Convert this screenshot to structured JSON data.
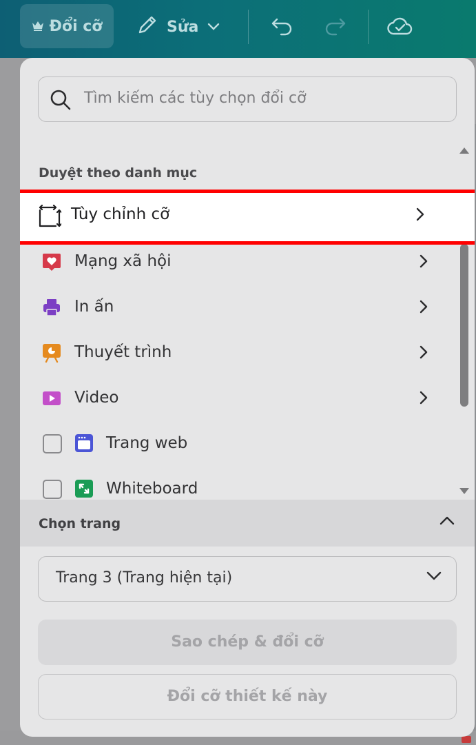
{
  "toolbar": {
    "resize_label": "Đổi cỡ",
    "edit_label": "Sửa"
  },
  "resize_panel": {
    "search": {
      "placeholder": "Tìm kiếm các tùy chọn đổi cỡ"
    },
    "browse_title": "Duyệt theo danh mục",
    "categories": [
      {
        "label": "Tùy chỉnh cỡ",
        "icon": "custom-size-icon",
        "highlighted": true
      },
      {
        "label": "Mạng xã hội",
        "icon": "heart-icon",
        "color": "#d63a4a"
      },
      {
        "label": "In ấn",
        "icon": "printer-icon",
        "color": "#7c3fc4"
      },
      {
        "label": "Thuyết trình",
        "icon": "presentation-icon",
        "color": "#e58a1f"
      },
      {
        "label": "Video",
        "icon": "video-icon",
        "color": "#c34fc9"
      }
    ],
    "checkbox_items": [
      {
        "label": "Trang web",
        "icon": "webpage-icon",
        "color": "#4b55d6",
        "checked": false
      },
      {
        "label": "Whiteboard",
        "icon": "whiteboard-icon",
        "color": "#1a9c55",
        "checked": false
      }
    ],
    "choose_page_title": "Chọn trang",
    "page_select_value": "Trang 3 (Trang hiện tại)",
    "copy_resize_label": "Sao chép & đổi cỡ",
    "resize_this_label": "Đổi cỡ thiết kế này"
  },
  "colors": {
    "highlight_border": "#ff0000",
    "topbar": "#0c6f78",
    "panel": "#e6e6e7"
  }
}
